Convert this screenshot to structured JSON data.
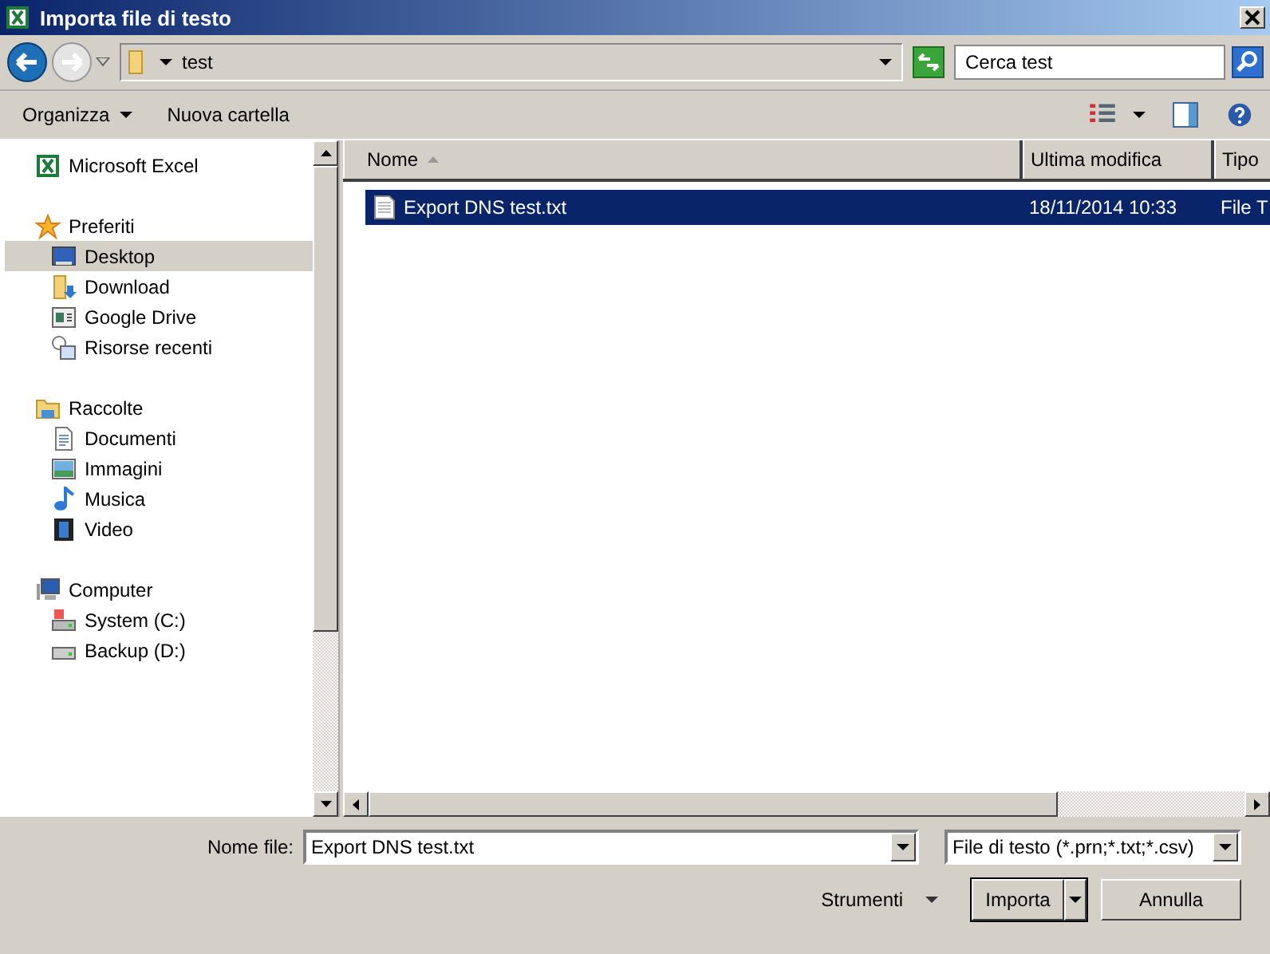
{
  "window": {
    "title": "Importa file di testo"
  },
  "address": {
    "path": "test",
    "search_placeholder": "Cerca test"
  },
  "toolbar": {
    "organize": "Organizza",
    "new_folder": "Nuova cartella"
  },
  "sidebar": [
    {
      "label": "Microsoft Excel",
      "selected": false
    },
    {
      "label": "Preferiti",
      "selected": false,
      "children": [
        {
          "label": "Desktop",
          "selected": true
        },
        {
          "label": "Download",
          "selected": false
        },
        {
          "label": "Google Drive",
          "selected": false
        },
        {
          "label": "Risorse recenti",
          "selected": false
        }
      ]
    },
    {
      "label": "Raccolte",
      "selected": false,
      "children": [
        {
          "label": "Documenti",
          "selected": false
        },
        {
          "label": "Immagini",
          "selected": false
        },
        {
          "label": "Musica",
          "selected": false
        },
        {
          "label": "Video",
          "selected": false
        }
      ]
    },
    {
      "label": "Computer",
      "selected": false,
      "children": [
        {
          "label": "System (C:)",
          "selected": false
        },
        {
          "label": "Backup (D:)",
          "selected": false
        }
      ]
    }
  ],
  "file_list": {
    "columns": [
      "Nome",
      "Ultima modifica",
      "Tipo"
    ],
    "rows": [
      {
        "name": "Export DNS test.txt",
        "modified": "18/11/2014 10:33",
        "type": "File T",
        "selected": true
      }
    ]
  },
  "footer": {
    "filename_label": "Nome file:",
    "filename_value": "Export DNS test.txt",
    "filter": "File di testo (*.prn;*.txt;*.csv)",
    "tools": "Strumenti",
    "import": "Importa",
    "cancel": "Annulla"
  }
}
